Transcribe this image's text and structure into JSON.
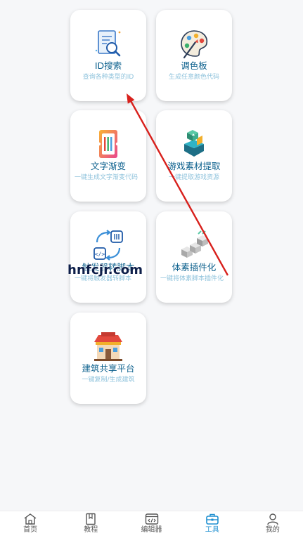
{
  "tools": [
    {
      "id": "id-search",
      "title": "ID搜索",
      "desc": "查询各种类型的ID"
    },
    {
      "id": "palette",
      "title": "调色板",
      "desc": "生成任意颜色代码"
    },
    {
      "id": "gradient",
      "title": "文字渐变",
      "desc": "一键生成文字渐变代码"
    },
    {
      "id": "game",
      "title": "游戏素材提取",
      "desc": "一键提取游戏资源"
    },
    {
      "id": "trigger",
      "title": "触发器转脚本",
      "desc": "一键将触发器转脚本"
    },
    {
      "id": "voxel",
      "title": "体素插件化",
      "desc": "一键将体素脚本插件化"
    },
    {
      "id": "building",
      "title": "建筑共享平台",
      "desc": "一键复制/生成建筑"
    }
  ],
  "nav": [
    {
      "label": "首页",
      "icon": "home-icon"
    },
    {
      "label": "教程",
      "icon": "book-icon"
    },
    {
      "label": "编辑器",
      "icon": "code-editor-icon"
    },
    {
      "label": "工具",
      "icon": "toolbox-icon",
      "active": true
    },
    {
      "label": "我的",
      "icon": "user-icon"
    }
  ],
  "watermark": "hnfcjr.com",
  "colors": {
    "title": "#0a5f8c",
    "desc": "#8fc3dc",
    "active_nav": "#1e8fd0",
    "arrow": "#d8201c"
  }
}
